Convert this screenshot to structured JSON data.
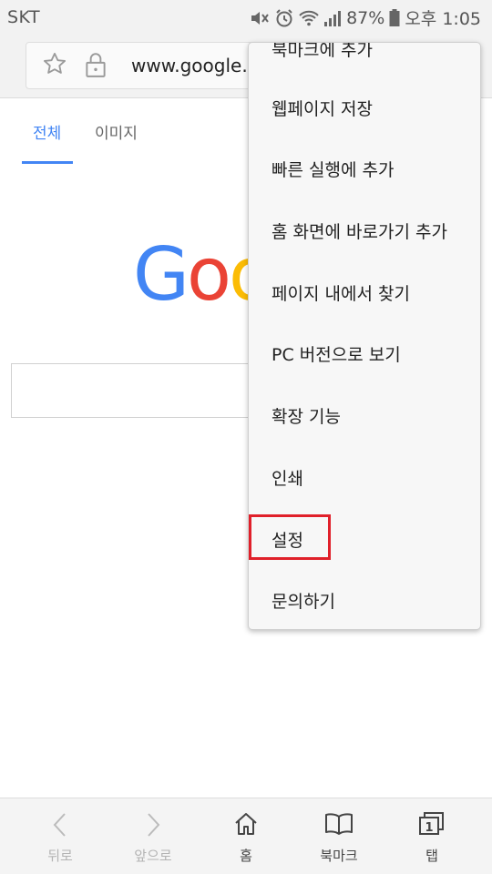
{
  "status_bar": {
    "carrier": "SKT",
    "battery": "87%",
    "time": "오후 1:05"
  },
  "url_bar": {
    "url": "www.google.co"
  },
  "search_tabs": {
    "all": "전체",
    "images": "이미지"
  },
  "colors": {
    "google_blue": "#4285f4",
    "google_red": "#ea4335",
    "google_yellow": "#fbbc05",
    "highlight": "#e0202a"
  },
  "menu": {
    "items": [
      "북마크에 추가",
      "웹페이지 저장",
      "빠른 실행에 추가",
      "홈 화면에 바로가기 추가",
      "페이지 내에서 찾기",
      "PC 버전으로 보기",
      "확장 기능",
      "인쇄",
      "설정",
      "문의하기"
    ],
    "highlighted": "설정"
  },
  "toolbar": {
    "back": "뒤로",
    "forward": "앞으로",
    "home": "홈",
    "bookmarks": "북마크",
    "tabs": "탭",
    "tab_count": "1"
  }
}
